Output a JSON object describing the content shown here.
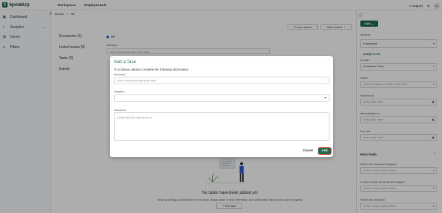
{
  "app": {
    "logo_text": "SpeakUp"
  },
  "topnav": {
    "items": [
      "Workspaces",
      "Employee Hub"
    ]
  },
  "topright": {
    "support": "Support",
    "avatar_initials": "LL"
  },
  "sidebar": {
    "items": [
      "Dashboard",
      "Analytics",
      "Issues",
      "Filters"
    ]
  },
  "breadcrumb": {
    "root": "Issues",
    "current": "69"
  },
  "header_buttons": {
    "user_access": "User access",
    "more_actions": "More actions",
    "new": "New"
  },
  "main": {
    "left_menu": [
      "Documents (0)",
      "Linked issues (0)",
      "Tasks (0)",
      "Activity"
    ],
    "status_number": "69",
    "summary_label": "Summary",
    "summary_placeholder": "Add a few words about this issue",
    "empty_title": "No tasks have been added yet",
    "empty_sub": "Start by setting up workflows for this issue, assign tasks to team members, and easily keep tabs on the case's progress",
    "new_task": "New task"
  },
  "right_panel": {
    "assignee_label": "Assignee",
    "assignee_value": "Unassigned",
    "assign_to_me": "Assign to me",
    "domain_label": "Domain*",
    "domain_value": "Compliance Team",
    "labels_label": "Labels",
    "labels_placeholder": "Select an option or create a new label",
    "received_label": "Received on",
    "received_placeholder": "Select date / time",
    "acknowledged_label": "Acknowledged on",
    "acknowledged_placeholder": "Select date / time",
    "due_label": "Due date",
    "due_placeholder": "Select date / time",
    "more_fields": "More fields",
    "q1_label": "What is the misconduct category?",
    "q1_placeholder": "Select / search option below",
    "q2_label": "In which country did the incident happen?",
    "q2_placeholder": "Select / search option below",
    "q3_label": "What is the conclusion",
    "q3_placeholder": "Select / search option below"
  },
  "modal": {
    "title": "Add a Task",
    "subtitle": "To continue, please complete the following information:",
    "summary_label": "Summary*",
    "summary_placeholder": "Add a few words about the task",
    "assignee_label": "Assignee",
    "description_label": "Description",
    "description_placeholder": "Detail what the task is about...",
    "cancel": "Cancel",
    "add": "Add"
  },
  "colors": {
    "brand": "#1f6b4f",
    "highlight": "#d9482b"
  }
}
